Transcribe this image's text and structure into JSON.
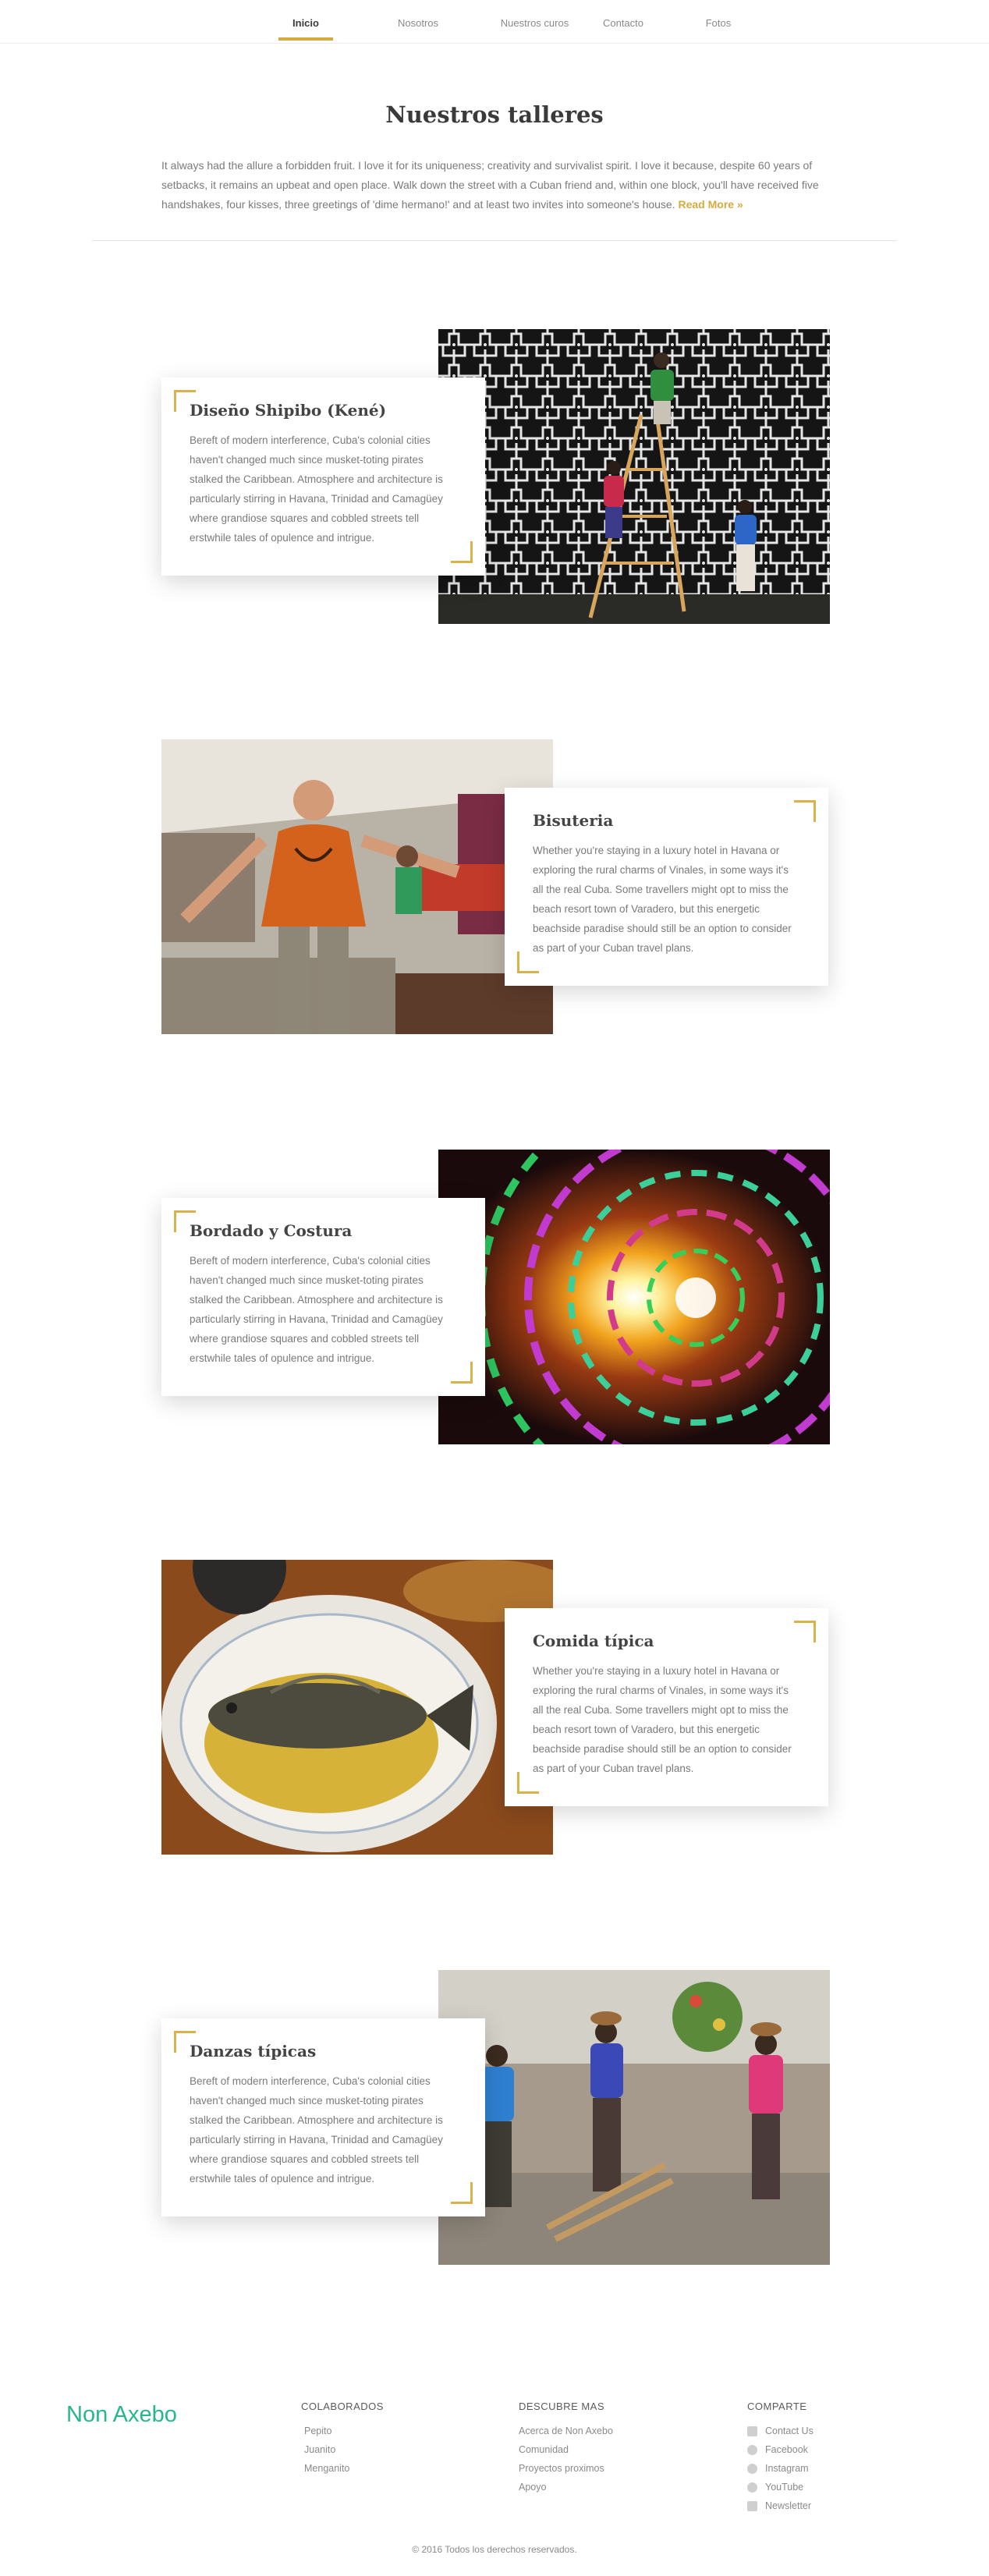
{
  "nav": {
    "items": [
      "Inicio",
      "Nosotros",
      "Nuestros curos",
      "Contacto",
      "Fotos"
    ],
    "active": "Inicio",
    "accent": "#d4ab3f"
  },
  "intro": {
    "title": "Nuestros talleres",
    "text": "It always had the allure a forbidden fruit. I love it for its uniqueness; creativity and survivalist spirit. I love it because, despite 60 years of setbacks, it remains an upbeat and open place. Walk down the street with a Cuban friend and, within one block, you'll have received five handshakes, four kisses, three greetings of 'dime hermano!' and at least two invites into someone's house.",
    "read_more": "Read More »"
  },
  "workshops": [
    {
      "title": "Diseño Shipibo (Kené)",
      "text": "Bereft of modern interference, Cuba's colonial cities haven't changed much since musket-toting pirates stalked the Caribbean. Atmosphere and architecture is particularly stirring in Havana, Trinidad and Camagüey where grandiose squares and cobbled streets tell erstwhile tales of opulence and intrigue.",
      "image": "painting-mural-photo"
    },
    {
      "title": "Bisuteria",
      "text": "Whether you're staying in a luxury hotel in Havana or exploring the rural charms of Vinales, in some ways it's all the real Cuba. Some travellers might opt to miss the beach resort town of Varadero, but this energetic beachside paradise should still  be an option to consider as part of your Cuban travel plans.",
      "image": "market-vendor-photo"
    },
    {
      "title": "Bordado y Costura",
      "text": "Bereft of modern interference, Cuba's colonial cities haven't changed much since musket-toting pirates stalked the Caribbean. Atmosphere and architecture is particularly stirring in Havana, Trinidad and Camagüey where grandiose squares and cobbled streets tell erstwhile tales of opulence and intrigue.",
      "image": "psychedelic-pattern-photo"
    },
    {
      "title": "Comida típica",
      "text": "Whether you're staying in a luxury hotel in Havana or exploring the rural charms of Vinales, in some ways it's all the real Cuba. Some travellers might opt to miss the beach resort town of Varadero, but this energetic beachside paradise should still  be an option to consider as part of your Cuban travel plans.",
      "image": "fish-dish-photo"
    },
    {
      "title": "Danzas típicas",
      "text": "Bereft of modern interference, Cuba's colonial cities haven't changed much since musket-toting pirates stalked the Caribbean. Atmosphere and architecture is particularly stirring in Havana, Trinidad and Camagüey where grandiose squares and cobbled streets tell erstwhile tales of opulence and intrigue.",
      "image": "dancers-photo"
    }
  ],
  "footer": {
    "brand": "Non Axebo",
    "brand_color": "#27b78d",
    "colaborados": {
      "heading": "COLABORADOS",
      "links": [
        "Pepito",
        "Juanito",
        "Menganito"
      ]
    },
    "descubre": {
      "heading": "DESCUBRE MAS",
      "links": [
        "Acerca de Non Axebo",
        "Comunidad",
        "Proyectos proximos",
        "Apoyo"
      ]
    },
    "comparte": {
      "heading": "COMPARTE",
      "links": [
        {
          "label": "Contact Us",
          "icon": "chat-icon"
        },
        {
          "label": "Facebook",
          "icon": "facebook-icon"
        },
        {
          "label": "Instagram",
          "icon": "instagram-icon"
        },
        {
          "label": "YouTube",
          "icon": "youtube-icon"
        },
        {
          "label": "Newsletter",
          "icon": "mail-icon"
        }
      ]
    },
    "copyright": "© 2016 Todos los derechos reservados."
  }
}
